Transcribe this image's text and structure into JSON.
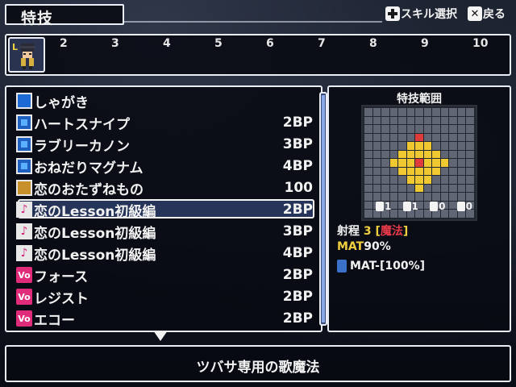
{
  "screen_title": "特技",
  "help": {
    "skill_select": "スキル選択",
    "back": "戻る"
  },
  "party": {
    "slot1_level_tag": "L",
    "slots": [
      "2",
      "3",
      "4",
      "5",
      "6",
      "7",
      "8",
      "9",
      "10"
    ]
  },
  "skills": [
    {
      "name": "しゃがき",
      "cost": "",
      "icon": "wave-icon"
    },
    {
      "name": "ハートスナイプ",
      "cost": "2BP",
      "icon": "square-skill-icon"
    },
    {
      "name": "ラブリーカノン",
      "cost": "3BP",
      "icon": "square-skill-icon"
    },
    {
      "name": "おねだりマグナム",
      "cost": "4BP",
      "icon": "square-skill-icon"
    },
    {
      "name": "恋のおたずねもの",
      "cost": "100",
      "icon": "gold-skill-icon"
    },
    {
      "name": "恋のLesson初級編",
      "cost": "2BP",
      "icon": "music-note-icon"
    },
    {
      "name": "恋のLesson初級編",
      "cost": "3BP",
      "icon": "music-note-icon"
    },
    {
      "name": "恋のLesson初級編",
      "cost": "4BP",
      "icon": "music-note-icon"
    },
    {
      "name": "フォース",
      "cost": "2BP",
      "icon": "vo-icon"
    },
    {
      "name": "レジスト",
      "cost": "2BP",
      "icon": "vo-icon"
    },
    {
      "name": "エコー",
      "cost": "2BP",
      "icon": "vo-icon"
    }
  ],
  "selected_index": 5,
  "range_panel": {
    "title": "特技範囲",
    "stat_values": [
      "1",
      "1",
      "0",
      "0"
    ],
    "range_label": "射程",
    "range_value": "3",
    "range_type": "魔法",
    "mat_label": "MAT",
    "mat_value": "90%",
    "mat_debuff": "MAT-[100%]"
  },
  "description": "ツバサ専用の歌魔法",
  "colors": {
    "panel_border": "#e9eef6",
    "grid_cell": "#606674",
    "area_cell": "#f0c832",
    "center_cell": "#e03a3a",
    "highlight": "#f0d040",
    "magic_red": "#e83a4a"
  }
}
